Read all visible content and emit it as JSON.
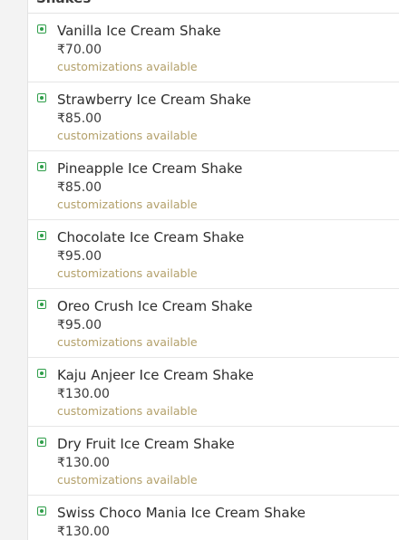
{
  "section": {
    "title": "Shakes"
  },
  "colors": {
    "veg_mark": "#2f9e4a",
    "note_text": "#b3a06a",
    "background": "#f3f3f3"
  },
  "icons": {
    "item_marker": "veg-indicator-icon"
  },
  "items": [
    {
      "name": "Vanilla Ice Cream Shake",
      "price": "₹70.00",
      "note": "customizations available"
    },
    {
      "name": "Strawberry Ice Cream Shake",
      "price": "₹85.00",
      "note": "customizations available"
    },
    {
      "name": "Pineapple Ice Cream Shake",
      "price": "₹85.00",
      "note": "customizations available"
    },
    {
      "name": "Chocolate Ice Cream Shake",
      "price": "₹95.00",
      "note": "customizations available"
    },
    {
      "name": "Oreo Crush Ice Cream Shake",
      "price": "₹95.00",
      "note": "customizations available"
    },
    {
      "name": "Kaju Anjeer Ice Cream Shake",
      "price": "₹130.00",
      "note": "customizations available"
    },
    {
      "name": "Dry Fruit Ice Cream Shake",
      "price": "₹130.00",
      "note": "customizations available"
    },
    {
      "name": "Swiss Choco Mania Ice Cream Shake",
      "price": "₹130.00",
      "note": ""
    }
  ]
}
